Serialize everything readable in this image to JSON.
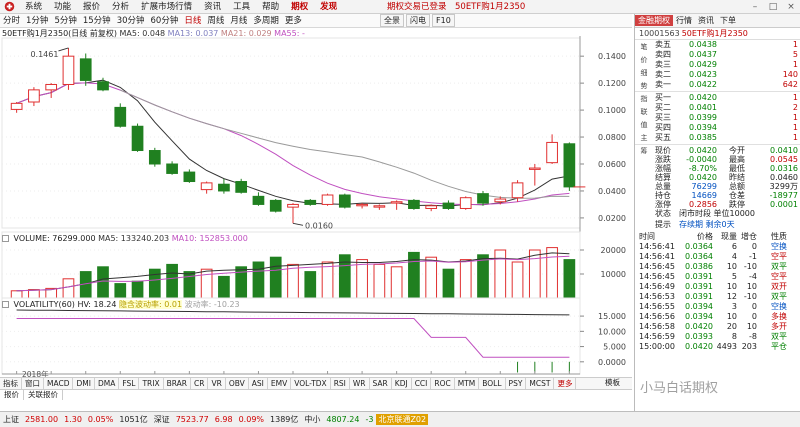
{
  "menubar": {
    "items": [
      "系统",
      "功能",
      "报价",
      "分析",
      "扩展市场行情",
      "资讯",
      "工具",
      "帮助",
      "期权",
      "发现"
    ],
    "status": "期权交易已登录",
    "contract": "50ETF购1月2350"
  },
  "period_bar": {
    "items": [
      "分时",
      "1分钟",
      "5分钟",
      "15分钟",
      "30分钟",
      "60分钟",
      "日线",
      "周线",
      "月线",
      "多周期",
      "更多"
    ],
    "active_index": 6
  },
  "view_toolbar": {
    "items": [
      "全景",
      "闪电",
      "F10"
    ]
  },
  "main_panel": {
    "title": "50ETF购1月2350(日线 前复权)",
    "ma5": "MA5: 0.048",
    "ma13": "MA13: 0.037",
    "ma21": "MA21: 0.029",
    "ma55": "MA55: -"
  },
  "vol_panel": {
    "title": "VOLUME: 76299.000",
    "ma5": "MA5: 133240.203",
    "ma10": "MA10: 152853.000"
  },
  "hv_panel": {
    "title": "VOLATILITY(60)  HV: 18.24",
    "legend_a": "隐含波动率: 0.01",
    "legend_b": "波动率: -10.23"
  },
  "chart_data": [
    {
      "type": "candlestick",
      "title": "50ETF购1月2350(日线 前复权)",
      "x": [
        "1",
        "2",
        "3",
        "4",
        "5",
        "6",
        "7",
        "8",
        "9",
        "10",
        "11",
        "12",
        "13",
        "14",
        "15",
        "16",
        "17",
        "18",
        "19",
        "20",
        "21",
        "22",
        "23",
        "24",
        "25",
        "26",
        "27",
        "28",
        "29",
        "30",
        "31",
        "32",
        "33",
        "34",
        "35",
        "36",
        "37"
      ],
      "ohlc": [
        [
          0.1005,
          0.106,
          0.098,
          0.105
        ],
        [
          0.106,
          0.117,
          0.103,
          0.115
        ],
        [
          0.115,
          0.12,
          0.109,
          0.119
        ],
        [
          0.119,
          0.1461,
          0.115,
          0.14
        ],
        [
          0.138,
          0.142,
          0.118,
          0.122
        ],
        [
          0.121,
          0.124,
          0.114,
          0.115
        ],
        [
          0.102,
          0.105,
          0.087,
          0.088
        ],
        [
          0.088,
          0.09,
          0.069,
          0.07
        ],
        [
          0.07,
          0.072,
          0.058,
          0.06
        ],
        [
          0.06,
          0.062,
          0.052,
          0.053
        ],
        [
          0.054,
          0.056,
          0.046,
          0.047
        ],
        [
          0.041,
          0.047,
          0.038,
          0.046
        ],
        [
          0.045,
          0.049,
          0.038,
          0.04
        ],
        [
          0.047,
          0.049,
          0.038,
          0.039
        ],
        [
          0.036,
          0.039,
          0.029,
          0.03
        ],
        [
          0.033,
          0.034,
          0.024,
          0.025
        ],
        [
          0.028,
          0.031,
          0.016,
          0.03
        ],
        [
          0.033,
          0.034,
          0.029,
          0.03
        ],
        [
          0.03,
          0.038,
          0.029,
          0.037
        ],
        [
          0.037,
          0.038,
          0.027,
          0.028
        ],
        [
          0.029,
          0.031,
          0.027,
          0.03
        ],
        [
          0.028,
          0.03,
          0.026,
          0.029
        ],
        [
          0.031,
          0.033,
          0.026,
          0.032
        ],
        [
          0.033,
          0.034,
          0.026,
          0.027
        ],
        [
          0.027,
          0.03,
          0.025,
          0.029
        ],
        [
          0.031,
          0.033,
          0.026,
          0.027
        ],
        [
          0.027,
          0.036,
          0.026,
          0.035
        ],
        [
          0.038,
          0.04,
          0.029,
          0.031
        ],
        [
          0.032,
          0.036,
          0.03,
          0.034
        ],
        [
          0.035,
          0.048,
          0.032,
          0.046
        ],
        [
          0.056,
          0.06,
          0.044,
          0.057
        ],
        [
          0.061,
          0.082,
          0.06,
          0.076
        ],
        [
          0.075,
          0.076,
          0.04,
          0.043
        ]
      ],
      "price_ticks": [
        "0.1400",
        "0.1200",
        "0.1000",
        "0.0800",
        "0.0600",
        "0.0400",
        "0.0200"
      ],
      "annotations": [
        "0.1461",
        "0.0160"
      ],
      "ylim": [
        0.014,
        0.152
      ]
    },
    {
      "type": "bar",
      "title": "VOLUME: 76299.000",
      "values": [
        3000,
        3500,
        4000,
        8000,
        11000,
        13000,
        6000,
        7000,
        12000,
        14000,
        11000,
        12000,
        9000,
        13000,
        15000,
        17000,
        14000,
        11000,
        15000,
        18000,
        16000,
        14000,
        13000,
        19000,
        17000,
        12000,
        16000,
        18000,
        20000,
        15000,
        20000,
        21000,
        16000,
        18000,
        9000,
        8000,
        9000
      ],
      "up": [
        true,
        true,
        true,
        true,
        false,
        false,
        false,
        false,
        false,
        false,
        false,
        false,
        true,
        false,
        false,
        false,
        true,
        true,
        false,
        true,
        true,
        true,
        true,
        false,
        true,
        false,
        true,
        true,
        false,
        true,
        true,
        false,
        true,
        false,
        false,
        false,
        true
      ],
      "ticks": [
        "20000",
        "10000"
      ],
      "ylim": [
        0,
        22500
      ]
    },
    {
      "type": "line",
      "title": "VOLATILITY(60)  HV: 18.24",
      "ticks": [
        "15.000",
        "10.000",
        "5.000",
        "0.0000"
      ],
      "ylim": [
        -4,
        17
      ]
    }
  ],
  "x_label": "2018年",
  "indicator_tabs": [
    "指标",
    "窗口",
    "MACD",
    "DMI",
    "DMA",
    "FSL",
    "TRIX",
    "BRAR",
    "CR",
    "VR",
    "OBV",
    "ASI",
    "EMV",
    "VOL-TDX",
    "RSI",
    "WR",
    "SAR",
    "KDJ",
    "CCI",
    "ROC",
    "MTM",
    "BOLL",
    "PSY",
    "MCST",
    "更多"
  ],
  "indicator_right": "模板",
  "sheet_tabs": [
    "报价",
    "关联报价"
  ],
  "statusbar": {
    "sh_label": "上证",
    "sh_value": "2581.00",
    "sh_change": "1.30",
    "sh_pct": "0.05%",
    "sh_amt": "1051亿",
    "sz_label": "深证",
    "sz_value": "7523.77",
    "sz_change": "6.98",
    "sz_pct": "0.09%",
    "sz_amt": "1389亿",
    "zx_label": "中小",
    "zx_value": "4807.24",
    "zx_change": "-3",
    "hk_label": "北京联通Z02"
  },
  "quote_panel": {
    "tabs": [
      "金融期权",
      "行情",
      "资讯",
      "下单"
    ],
    "code": "10001563",
    "name": "50ETF购1月2350",
    "asks": [
      {
        "label": "卖五",
        "price": "0.0438",
        "vol": "1"
      },
      {
        "label": "卖四",
        "price": "0.0437",
        "vol": "5"
      },
      {
        "label": "卖三",
        "price": "0.0429",
        "vol": "1"
      },
      {
        "label": "卖二",
        "price": "0.0423",
        "vol": "140"
      },
      {
        "label": "卖一",
        "price": "0.0422",
        "vol": "642"
      }
    ],
    "bids": [
      {
        "label": "买一",
        "price": "0.0420",
        "vol": "1"
      },
      {
        "label": "买二",
        "price": "0.0401",
        "vol": "2"
      },
      {
        "label": "买三",
        "price": "0.0399",
        "vol": "1"
      },
      {
        "label": "买四",
        "price": "0.0394",
        "vol": "1"
      },
      {
        "label": "买五",
        "price": "0.0385",
        "vol": "1"
      }
    ],
    "stats": [
      {
        "l1": "现价",
        "v1": "0.0420",
        "c1": "green",
        "l2": "今开",
        "v2": "0.0410",
        "c2": "green"
      },
      {
        "l1": "涨跌",
        "v1": "-0.0040",
        "c1": "green",
        "l2": "最高",
        "v2": "0.0545",
        "c2": "red"
      },
      {
        "l1": "涨幅",
        "v1": "-8.70%",
        "c1": "green",
        "l2": "最低",
        "v2": "0.0316",
        "c2": "green"
      },
      {
        "l1": "结算",
        "v1": "0.0420",
        "c1": "green",
        "l2": "昨结",
        "v2": "0.0460",
        "c2": ""
      },
      {
        "l1": "总量",
        "v1": "76299",
        "c1": "blue",
        "l2": "总额",
        "v2": "3299万",
        "c2": ""
      },
      {
        "l1": "持仓",
        "v1": "14669",
        "c1": "blue",
        "l2": "仓差",
        "v2": "-18977",
        "c2": "green"
      },
      {
        "l1": "涨停",
        "v1": "0.2856",
        "c1": "red",
        "l2": "跌停",
        "v2": "0.0001",
        "c2": "green"
      }
    ],
    "status_rows": [
      {
        "label": "状态",
        "value": "闭市时段  单位10000"
      },
      {
        "label": "提示",
        "value": "存续期 剩余0天"
      }
    ],
    "sidebar": [
      "笔",
      "价",
      "细",
      "势",
      "指",
      "联",
      "值",
      "主",
      "筹"
    ],
    "ticks_header": [
      "时间",
      "价格",
      "现量",
      "增仓",
      "性质"
    ],
    "ticks": [
      {
        "t": "14:56:41",
        "p": "0.0364",
        "q": "6",
        "c": "0",
        "n": "空换",
        "pc": "green",
        "nc": "blue"
      },
      {
        "t": "14:56:41",
        "p": "0.0364",
        "q": "4",
        "c": "-1",
        "n": "空平",
        "pc": "green",
        "nc": "red"
      },
      {
        "t": "14:56:45",
        "p": "0.0386",
        "q": "10",
        "c": "-10",
        "n": "双平",
        "pc": "green",
        "nc": "green"
      },
      {
        "t": "14:56:45",
        "p": "0.0391",
        "q": "5",
        "c": "-4",
        "n": "空平",
        "pc": "green",
        "nc": "red"
      },
      {
        "t": "14:56:49",
        "p": "0.0391",
        "q": "10",
        "c": "10",
        "n": "双开",
        "pc": "green",
        "nc": "red"
      },
      {
        "t": "14:56:53",
        "p": "0.0391",
        "q": "12",
        "c": "-10",
        "n": "双平",
        "pc": "green",
        "nc": "green"
      },
      {
        "t": "14:56:55",
        "p": "0.0394",
        "q": "3",
        "c": "0",
        "n": "空换",
        "pc": "green",
        "nc": "blue"
      },
      {
        "t": "14:56:56",
        "p": "0.0394",
        "q": "10",
        "c": "0",
        "n": "多换",
        "pc": "green",
        "nc": "red"
      },
      {
        "t": "14:56:58",
        "p": "0.0420",
        "q": "20",
        "c": "10",
        "n": "多开",
        "pc": "green",
        "nc": "red"
      },
      {
        "t": "14:56:59",
        "p": "0.0393",
        "q": "8",
        "c": "-8",
        "n": "双平",
        "pc": "green",
        "nc": "green"
      },
      {
        "t": "15:00:00",
        "p": "0.0420",
        "q": "4493",
        "c": "203",
        "n": "平仓",
        "pc": "green",
        "nc": "green"
      }
    ]
  },
  "watermark": "小马白话期权"
}
